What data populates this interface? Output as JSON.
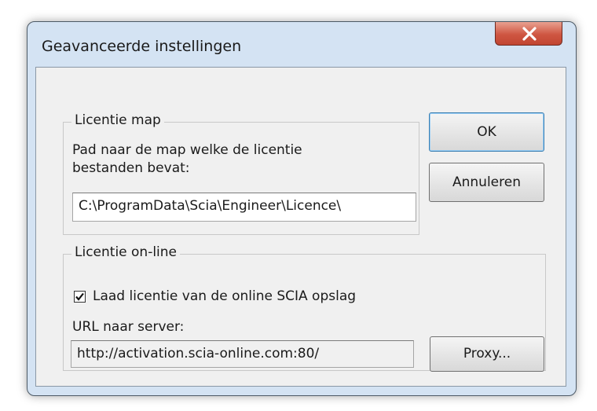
{
  "window": {
    "title": "Geavanceerde instellingen",
    "close_glyph": "close-icon"
  },
  "licence_folder": {
    "group_label": "Licentie map",
    "description_line1": "Pad naar de map welke de licentie",
    "description_line2": "bestanden bevat:",
    "path_value": "C:\\ProgramData\\Scia\\Engineer\\Licence\\"
  },
  "licence_online": {
    "group_label": "Licentie on-line",
    "checkbox_label": "Laad licentie van de online SCIA opslag",
    "checkbox_checked": true,
    "url_label": "URL naar server:",
    "url_value": "http://activation.scia-online.com:80/"
  },
  "buttons": {
    "ok": "OK",
    "cancel": "Annuleren",
    "proxy": "Proxy..."
  },
  "colors": {
    "frame": "#d4e3f3",
    "close_button": "#c94d3a",
    "client_bg": "#f0f0f0"
  }
}
